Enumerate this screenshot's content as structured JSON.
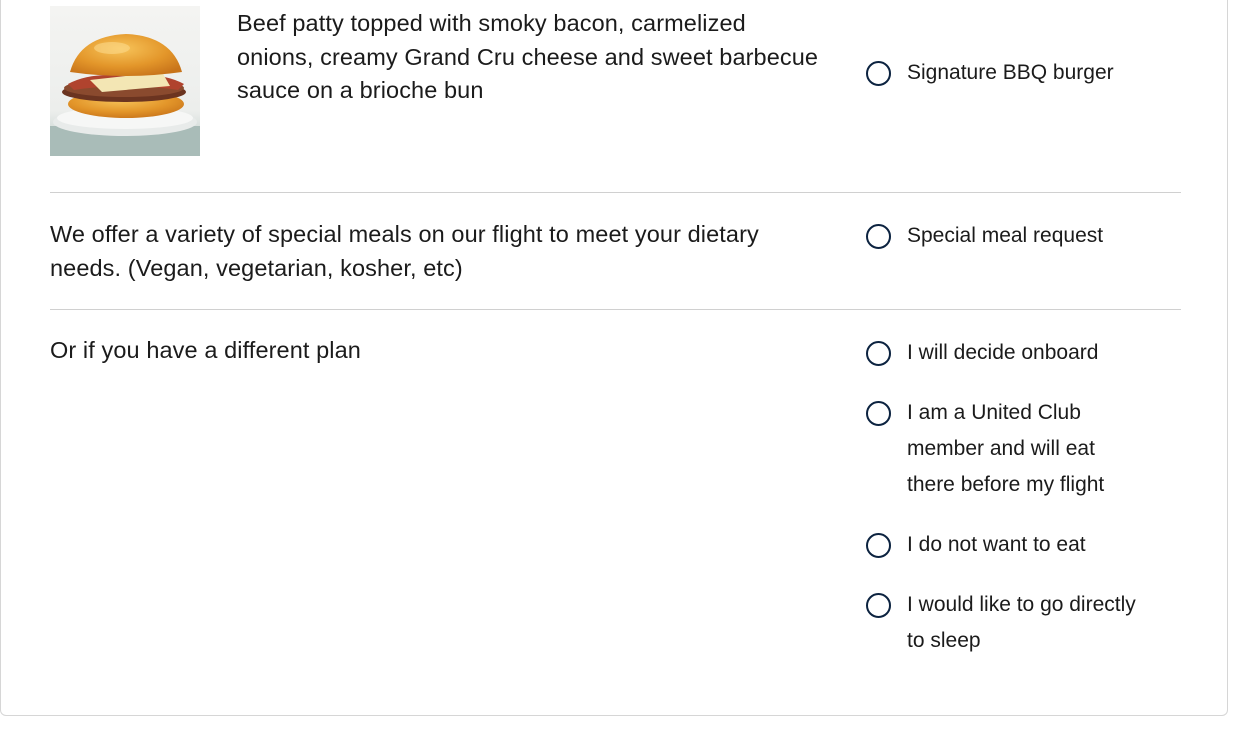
{
  "meal_options": {
    "burger": {
      "image_icon": "burger-image",
      "description": "Beef patty topped with smoky bacon, carmelized onions, creamy Grand Cru cheese and sweet barbecue sauce on a brioche bun",
      "option_label": "Signature BBQ burger",
      "selected": false
    },
    "special": {
      "description": "We offer a variety of special meals on our flight to meet your dietary needs. (Vegan, vegetarian, kosher, etc)",
      "option_label": "Special meal request",
      "selected": false
    },
    "different_plan": {
      "description": "Or if you have a different plan",
      "options": [
        {
          "label": "I will decide onboard",
          "selected": false
        },
        {
          "label": "I am a United Club member and will eat there before my flight",
          "selected": false
        },
        {
          "label": "I do not want to eat",
          "selected": false
        },
        {
          "label": "I would like to go directly to sleep",
          "selected": false
        }
      ]
    }
  },
  "colors": {
    "radio_border": "#0c2340",
    "divider": "#d0d0d0",
    "text": "#1b1b1b"
  }
}
